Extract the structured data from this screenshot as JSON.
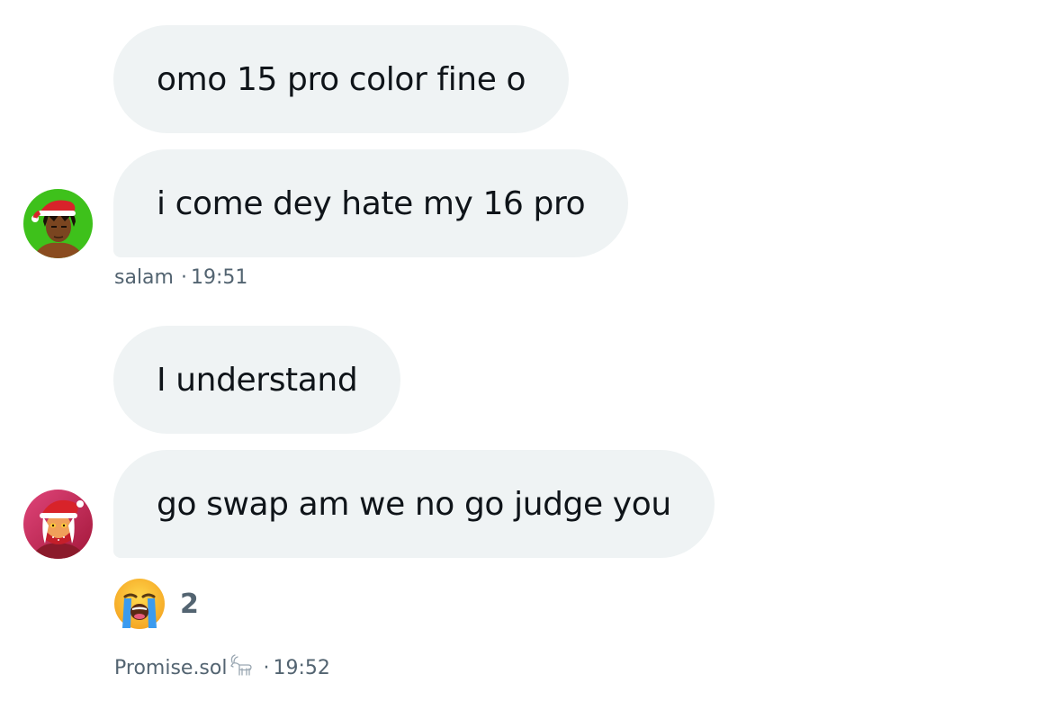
{
  "messages": [
    {
      "text": "omo 15 pro color fine o"
    },
    {
      "text": "i come dey hate my 16 pro"
    },
    {
      "text": "I understand"
    },
    {
      "text": "go swap am we no go judge you"
    }
  ],
  "groups": [
    {
      "sender": "salam",
      "separator": "·",
      "time": "19:51",
      "avatar": "santa-hat-avatar-green"
    },
    {
      "sender": "Promise.sol",
      "sender_badge": "goat-icon",
      "separator": "·",
      "time": "19:52",
      "avatar": "santa-hat-avatar-red"
    }
  ],
  "reaction": {
    "emoji": "loudly-crying-face-icon",
    "count": "2"
  },
  "colors": {
    "bubble": "#eff3f4",
    "text": "#0f1419",
    "meta": "#536471",
    "avatar1_bg": "#3ec11b",
    "avatar2_bg": "#c02b3a"
  }
}
